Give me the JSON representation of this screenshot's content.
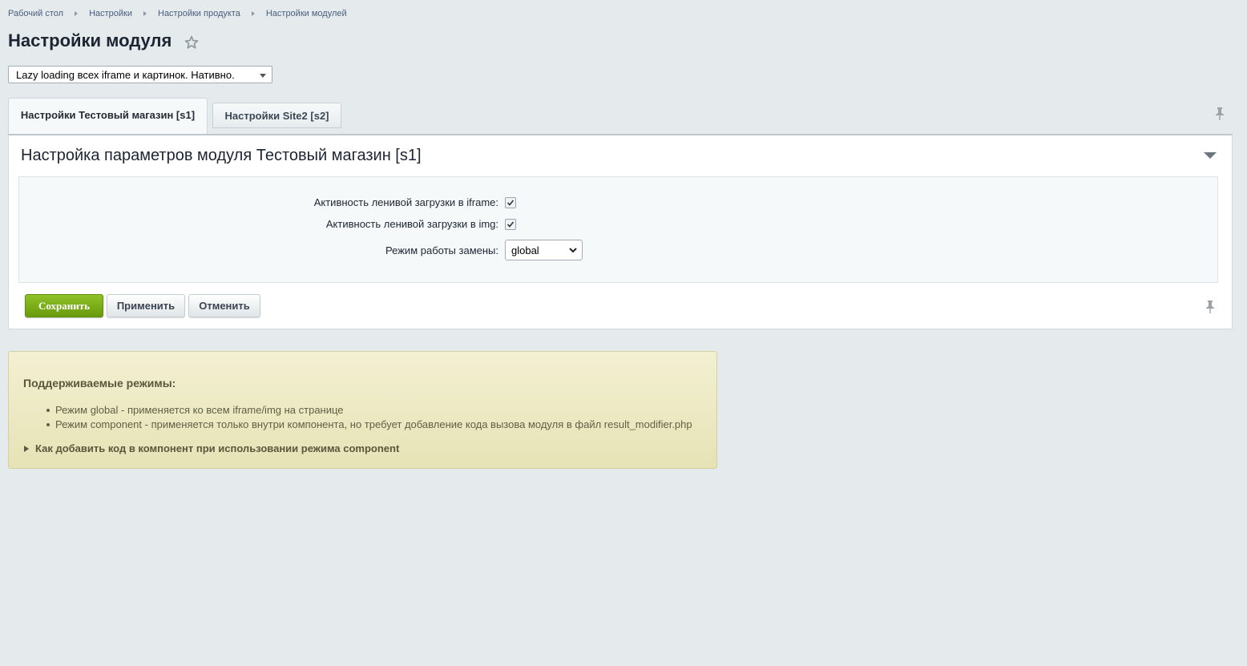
{
  "breadcrumb": [
    "Рабочий стол",
    "Настройки",
    "Настройки продукта",
    "Настройки модулей"
  ],
  "page": {
    "title": "Настройки модуля"
  },
  "module_select": {
    "value": "Lazy loading всех iframe и картинок. Нативно."
  },
  "tabs": [
    {
      "label": "Настройки Тестовый магазин [s1]",
      "active": true
    },
    {
      "label": "Настройки Site2 [s2]",
      "active": false
    }
  ],
  "panel": {
    "title": "Настройка параметров модуля Тестовый магазин [s1]",
    "fields": [
      {
        "label": "Активность ленивой загрузки в iframe:",
        "checked": true
      },
      {
        "label": "Активность ленивой загрузки в img:",
        "checked": true
      },
      {
        "label": "Режим работы замены:",
        "value": "global"
      }
    ],
    "buttons": {
      "save": "Сохранить",
      "apply": "Применить",
      "cancel": "Отменить"
    }
  },
  "info": {
    "title": "Поддерживаемые режимы:",
    "items": [
      "Режим global - применяется ко всем iframe/img на странице",
      "Режим component - применяется только внутри компонента, но требует добавление кода вызова модуля в файл result_modifier.php"
    ],
    "expander": "Как добавить код в компонент при использовании режима component"
  },
  "colors": {
    "save_button": "#7aab17",
    "background": "#e5ebed",
    "info_background": "#efecc9"
  },
  "icons": [
    "star-icon",
    "pin-icon",
    "collapse-icon",
    "check-icon",
    "chevron-down-icon"
  ]
}
